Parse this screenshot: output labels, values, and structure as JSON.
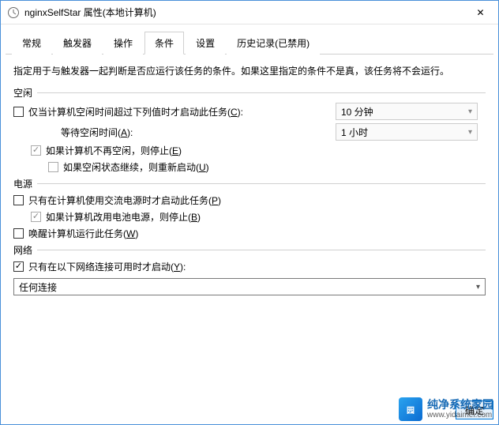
{
  "title": "nginxSelfStar 属性(本地计算机)",
  "close_glyph": "✕",
  "tabs": {
    "t0": "常规",
    "t1": "触发器",
    "t2": "操作",
    "t3": "条件",
    "t4": "设置",
    "t5": "历史记录(已禁用)"
  },
  "desc": "指定用于与触发器一起判断是否应运行该任务的条件。如果这里指定的条件不是真，该任务将不会运行。",
  "sections": {
    "idle": "空闲",
    "power": "电源",
    "network": "网络"
  },
  "idle": {
    "only_if_idle_pre": "仅当计算机空闲时间超过下列值时才启动此任务(",
    "only_if_idle_u": "C",
    "only_if_idle_post": "):",
    "idle_time": "10 分钟",
    "wait_label_pre": "等待空闲时间(",
    "wait_label_u": "A",
    "wait_label_post": "):",
    "wait_time": "1 小时",
    "stop_if_not_idle_pre": "如果计算机不再空闲，则停止(",
    "stop_if_not_idle_u": "E",
    "stop_if_not_idle_post": ")",
    "restart_if_idle_pre": "如果空闲状态继续，则重新启动(",
    "restart_if_idle_u": "U",
    "restart_if_idle_post": ")"
  },
  "power": {
    "ac_only_pre": "只有在计算机使用交流电源时才启动此任务(",
    "ac_only_u": "P",
    "ac_only_post": ")",
    "stop_batt_pre": "如果计算机改用电池电源，则停止(",
    "stop_batt_u": "B",
    "stop_batt_post": ")",
    "wake_pre": "唤醒计算机运行此任务(",
    "wake_u": "W",
    "wake_post": ")"
  },
  "network": {
    "only_net_pre": "只有在以下网络连接可用时才启动(",
    "only_net_u": "Y",
    "only_net_post": "):",
    "selected": "任何连接"
  },
  "buttons": {
    "ok": "确定"
  },
  "watermark": {
    "logo": "园",
    "cn": "纯净系统家园",
    "url": "www.yidaimei.com"
  }
}
